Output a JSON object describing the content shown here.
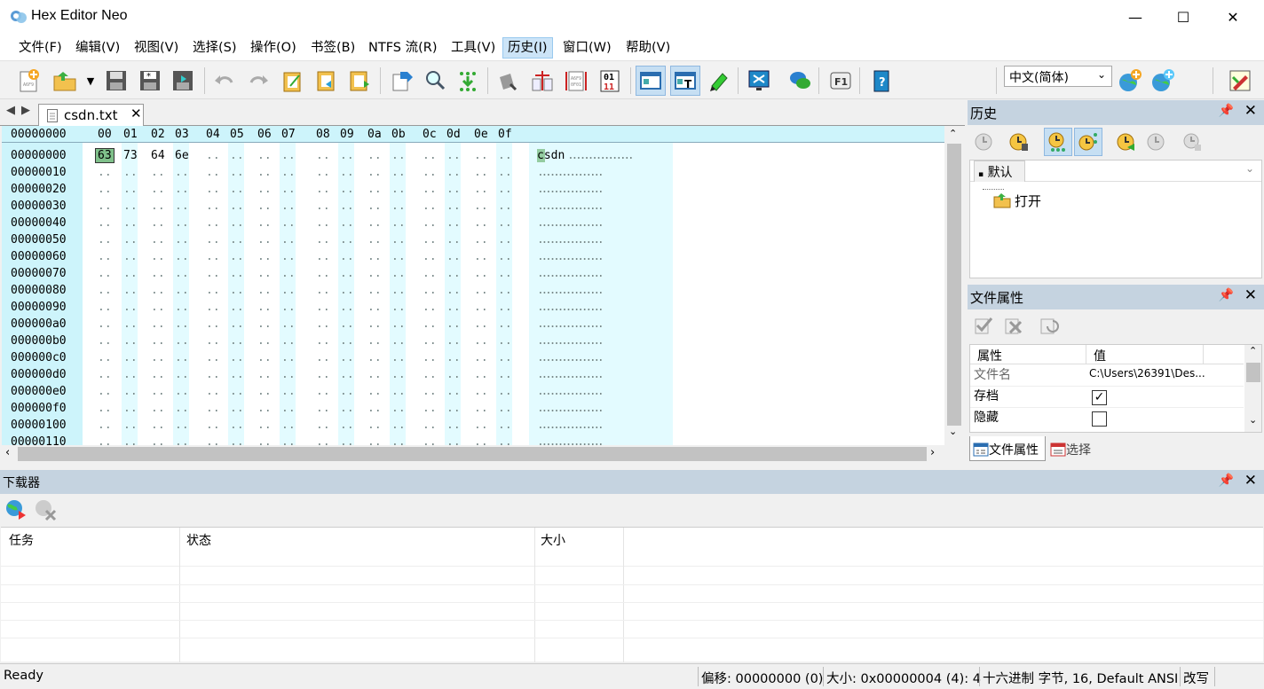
{
  "window": {
    "title": "Hex Editor Neo",
    "minimize": "—",
    "maximize": "☐",
    "close": "✕"
  },
  "menu": [
    "文件(F)",
    "编辑(V)",
    "视图(V)",
    "选择(S)",
    "操作(O)",
    "书签(B)",
    "NTFS 流(R)",
    "工具(V)",
    "历史(I)",
    "窗口(W)",
    "帮助(V)"
  ],
  "menu_active_index": 8,
  "toolbar": {
    "language": "中文(简体)",
    "icons": [
      "new-file-icon",
      "open-file-icon",
      "dropdown-arrow-icon",
      "save-icon",
      "save-all-icon",
      "save-as-icon",
      "undo-icon",
      "redo-icon",
      "paste-icon",
      "clipboard-import-icon",
      "clipboard-export-icon",
      "export-icon",
      "find-icon",
      "find-next-icon",
      "modify-data-icon",
      "compare-icon",
      "encoding-icon",
      "binary-icon",
      "hex-view-icon",
      "text-view-icon",
      "highlight-icon",
      "fullscreen-icon",
      "chat-icon",
      "f1-help-icon",
      "help-book-icon",
      "globe-add-icon",
      "globe-plus-icon",
      "edit-pen-icon"
    ]
  },
  "editor": {
    "tab_name": "csdn.txt",
    "header_offset": "00000000",
    "columns": [
      "00",
      "01",
      "02",
      "03",
      "04",
      "05",
      "06",
      "07",
      "08",
      "09",
      "0a",
      "0b",
      "0c",
      "0d",
      "0e",
      "0f"
    ],
    "rows": [
      "00000000",
      "00000010",
      "00000020",
      "00000030",
      "00000040",
      "00000050",
      "00000060",
      "00000070",
      "00000080",
      "00000090",
      "000000a0",
      "000000b0",
      "000000c0",
      "000000d0",
      "000000e0",
      "000000f0",
      "00000100",
      "00000110"
    ],
    "bytes": [
      "63",
      "73",
      "64",
      "6e"
    ],
    "text": "csdn",
    "empty_byte": "..",
    "empty_text": "................"
  },
  "history_panel": {
    "title": "历史",
    "tab": "默认",
    "entry": "打开"
  },
  "file_props_panel": {
    "title": "文件属性",
    "headers": [
      "属性",
      "值"
    ],
    "rows": [
      {
        "name": "文件名",
        "value": "C:\\Users\\26391\\Des..."
      },
      {
        "name": "存档",
        "checked": true
      },
      {
        "name": "隐藏",
        "checked": false
      }
    ],
    "tabs": [
      "文件属性",
      "选择"
    ]
  },
  "downloader": {
    "title": "下载器",
    "columns": [
      "任务",
      "状态",
      "大小"
    ]
  },
  "status": {
    "ready": "Ready",
    "offset": "偏移: 00000000 (0)",
    "size": "大小: 0x00000004 (4): 4",
    "mode": "十六进制 字节, 16, Default ANSI",
    "overwrite": "改写"
  },
  "colors": {
    "accent_header": "#c5d3e0",
    "hex_bg": "#cdf4fb",
    "selected_byte": "#7fc08a"
  }
}
